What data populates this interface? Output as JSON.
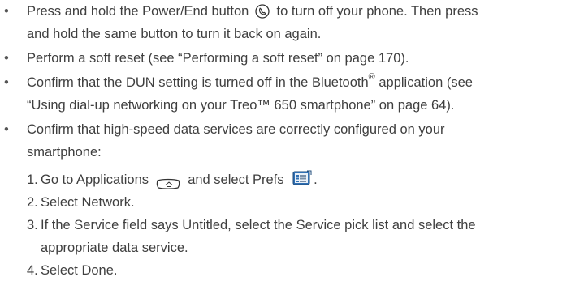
{
  "bullets": [
    {
      "line1_a": "Press and hold the Power/End button",
      "icon": "power-end-icon",
      "line1_b": "to turn off your phone. Then press",
      "line2": "and hold the same button to turn it back on again."
    },
    {
      "line1": "Perform a soft reset (see “Performing a soft reset” on page 170)."
    },
    {
      "line1_a": "Confirm that the DUN setting is turned off in the Bluetooth",
      "reg": "®",
      "line1_b": " application (see",
      "line2": "“Using dial-up networking on your Treo™ 650 smartphone” on page 64)."
    },
    {
      "line1": "Confirm that high-speed data services are correctly configured on your",
      "line2": "smartphone:"
    }
  ],
  "steps": [
    {
      "num": "1.",
      "text_a": "Go to Applications",
      "icon_a": "applications-icon",
      "text_b": "and select Prefs",
      "icon_b": "prefs-icon",
      "text_c": "."
    },
    {
      "num": "2.",
      "text": "Select Network."
    },
    {
      "num": "3.",
      "line1": "If the Service field says Untitled, select the Service pick list and select the",
      "line2": "appropriate data service."
    },
    {
      "num": "4.",
      "text": "Select Done."
    }
  ]
}
